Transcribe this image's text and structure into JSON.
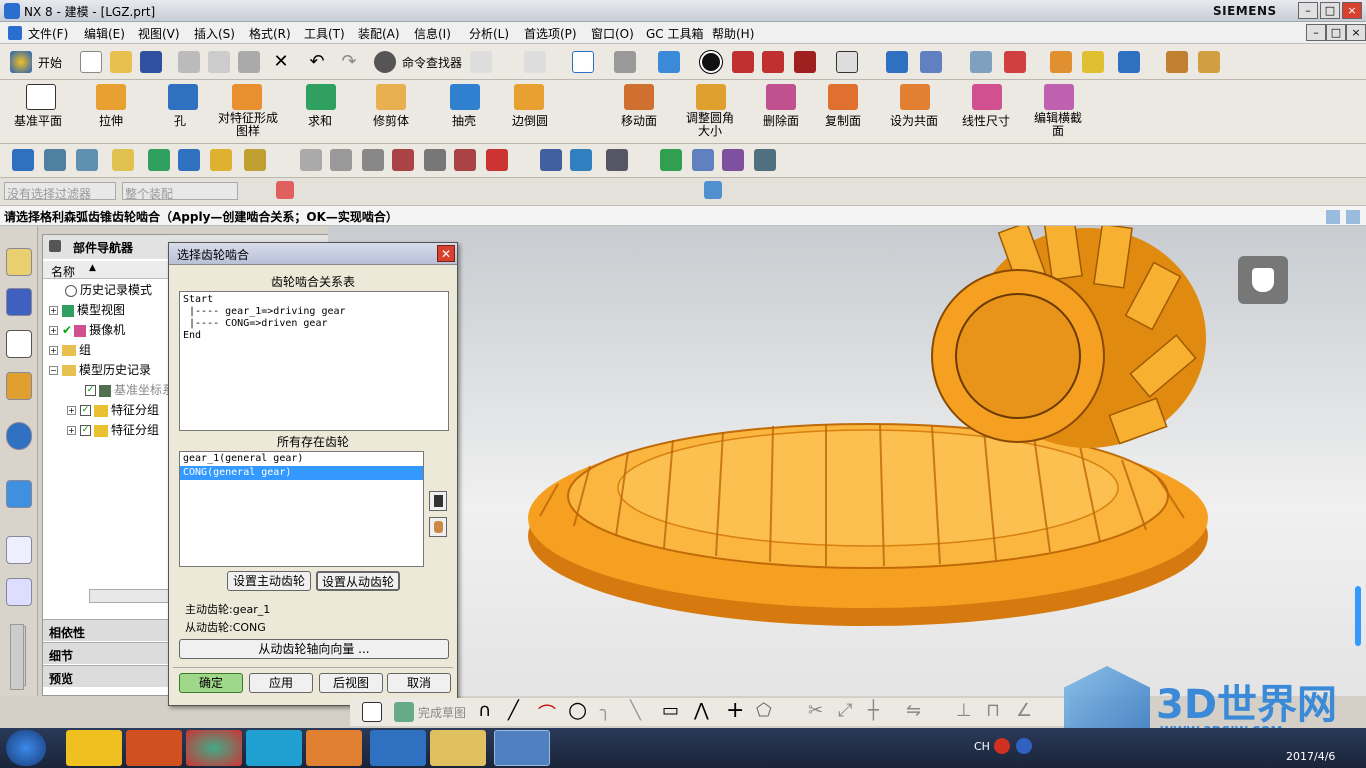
{
  "window": {
    "title": "NX 8 - 建模 - [LGZ.prt]",
    "brand": "SIEMENS"
  },
  "menu": [
    "文件(F)",
    "编辑(E)",
    "视图(V)",
    "插入(S)",
    "格式(R)",
    "工具(T)",
    "装配(A)",
    "信息(I)",
    "分析(L)",
    "首选项(P)",
    "窗口(O)",
    "GC 工具箱",
    "帮助(H)"
  ],
  "toolbar1": {
    "start_label": "开始",
    "command_finder": "命令查找器"
  },
  "toolbar2": [
    "基准平面",
    "拉伸",
    "孔",
    "对特征形成图样",
    "求和",
    "修剪体",
    "抽壳",
    "边倒圆",
    "移动面",
    "调整圆角大小",
    "删除面",
    "复制面",
    "设为共面",
    "线性尺寸",
    "编辑横截面"
  ],
  "selection": {
    "filter": "没有选择过滤器",
    "scope": "整个装配"
  },
  "status_text": "请选择格利森弧齿锥齿轮啮合（Apply—创建啮合关系；OK—实现啮合）",
  "navigator": {
    "title": "部件导航器",
    "column": "名称",
    "rows": [
      "历史记录模式",
      "模型视图",
      "摄像机",
      "组",
      "模型历史记录",
      "基准坐标系",
      "特征分组",
      "特征分组"
    ],
    "sections": [
      "相依性",
      "细节",
      "预览"
    ]
  },
  "dialog": {
    "title": "选择齿轮啮合",
    "relation_label": "齿轮啮合关系表",
    "relation_text": "Start\n |---- gear_1=>driving gear\n |---- CONG=>driven gear\nEnd",
    "gears_label": "所有存在齿轮",
    "gears": [
      "gear_1(general gear)",
      "CONG(general gear)"
    ],
    "selected_gear": 1,
    "btn_driving": "设置主动齿轮",
    "btn_driven": "设置从动齿轮",
    "driving_text": "主动齿轮:gear_1",
    "driven_text": "从动齿轮:CONG",
    "axis_btn": "从动齿轮轴向向量 ...",
    "ok": "确定",
    "apply": "应用",
    "back": "后视图",
    "cancel": "取消"
  },
  "bottom_toolbar": {
    "finish_sketch": "完成草图"
  },
  "tray": {
    "lang": "CH",
    "date": "2017/4/6"
  },
  "watermark": {
    "text": "3D世界网",
    "url": "WWW.3DSJW.COM"
  },
  "colors": {
    "gear": "#f5a020",
    "accent": "#3399ff",
    "ok_button": "#9fd88a"
  }
}
